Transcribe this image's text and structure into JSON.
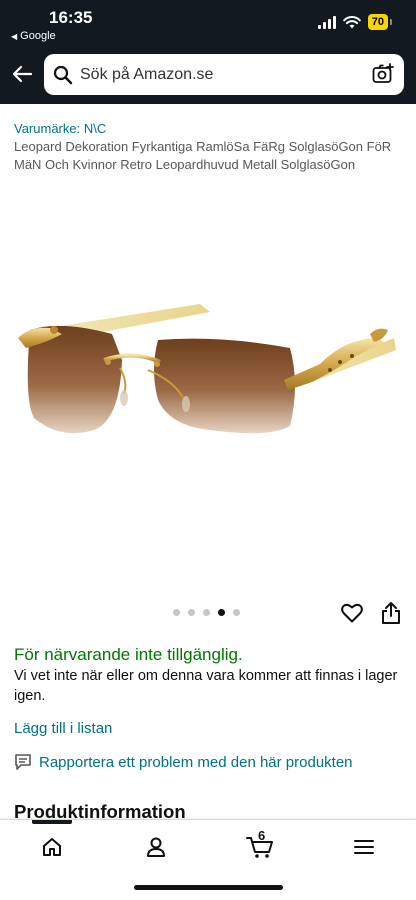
{
  "status_bar": {
    "time": "16:35",
    "back_app": "Google",
    "battery": "70"
  },
  "header": {
    "search_placeholder": "Sök på Amazon.se"
  },
  "product": {
    "brand": "Varumärke: N\\C",
    "title": "Leopard Dekoration Fyrkantiga RamlöSa FäRg SolglasöGon FöR MäN Och Kvinnor Retro Leopardhuvud Metall SolglasöGon",
    "image_count": 5,
    "active_image": 4,
    "availability": "För närvarande inte tillgänglig.",
    "availability_desc": "Vi vet inte när eller om denna vara kommer att finnas i lager igen.",
    "add_to_list": "Lägg till i listan",
    "report_problem": "Rapportera ett problem med den här produkten"
  },
  "section": {
    "product_info_heading": "Produktinformation"
  },
  "bottom_nav": {
    "cart_count": "6",
    "items": [
      "home",
      "account",
      "cart",
      "menu"
    ]
  },
  "colors": {
    "header_bg": "#131921",
    "link": "#007185",
    "available_green": "#007600",
    "battery": "#f7d700"
  }
}
